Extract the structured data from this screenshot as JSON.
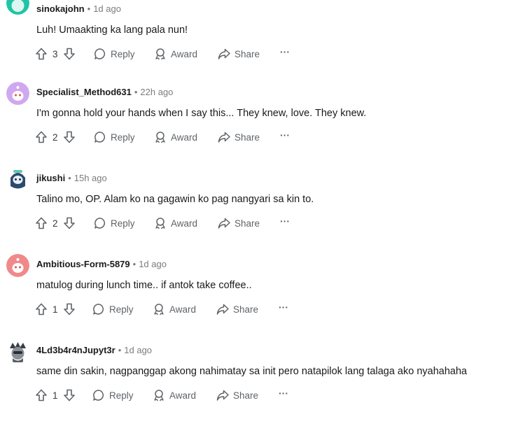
{
  "comments": [
    {
      "author": "sinokajohn",
      "time": "1d ago",
      "text": "Luh! Umaakting ka lang pala nun!",
      "score": "3",
      "avatar_color": "#1fc4a6",
      "avatar_icon": "snoo-avatar-teal"
    },
    {
      "author": "Specialist_Method631",
      "time": "22h ago",
      "text": "I'm gonna hold your hands when I say this... They knew, love. They knew.",
      "score": "2",
      "avatar_color": "#cfa8f0",
      "avatar_icon": "snoo-avatar-purple"
    },
    {
      "author": "jikushi",
      "time": "15h ago",
      "text": "Talino mo, OP. Alam ko na gagawin ko pag nangyari sa kin to.",
      "score": "2",
      "avatar_color": "#2d4a6e",
      "avatar_icon": "custom-avatar-blue"
    },
    {
      "author": "Ambitious-Form-5879",
      "time": "1d ago",
      "text": "matulog during lunch time.. if antok take coffee..",
      "score": "1",
      "avatar_color": "#f08a8a",
      "avatar_icon": "snoo-avatar-red"
    },
    {
      "author": "4Ld3b4r4nJupyt3r",
      "time": "1d ago",
      "text": "same din sakin, nagpanggap akong nahimatay sa init pero natapilok lang talaga ako nyahahaha",
      "score": "1",
      "avatar_color": "#8a8f96",
      "avatar_icon": "custom-avatar-gray"
    }
  ],
  "actions": {
    "reply_label": "Reply",
    "award_label": "Award",
    "share_label": "Share",
    "more_label": "···"
  },
  "colors": {
    "text": "#1a1a1b",
    "muted": "#7c7c7c",
    "action": "#5f6367"
  }
}
